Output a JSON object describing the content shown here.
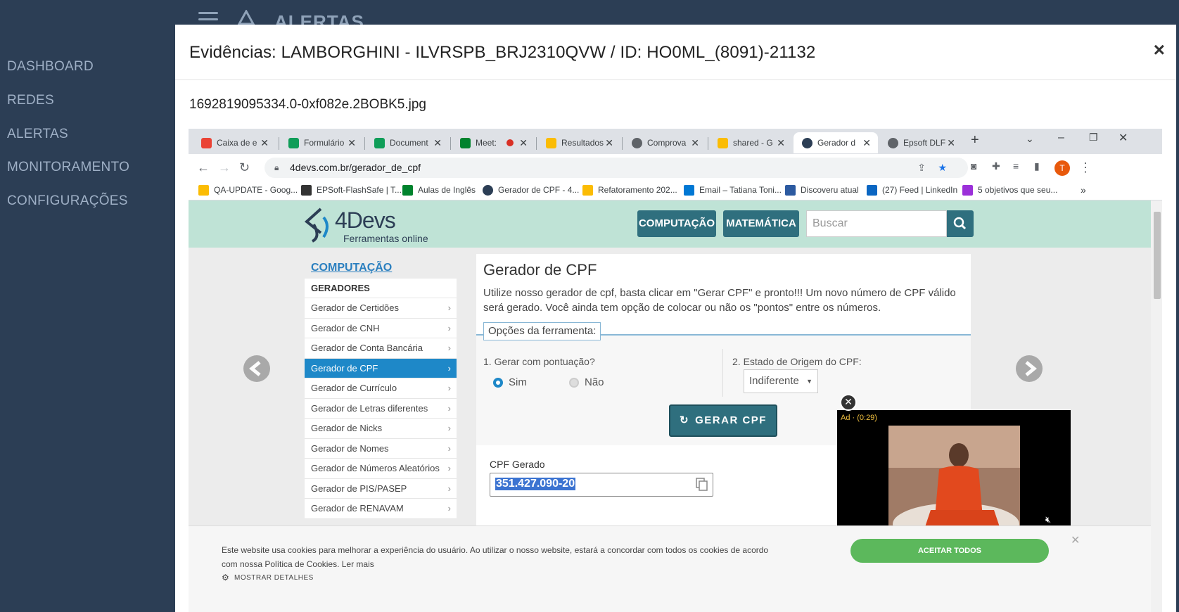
{
  "sidebar": {
    "items": [
      {
        "label": "DASHBOARD"
      },
      {
        "label": "REDES"
      },
      {
        "label": "ALERTAS"
      },
      {
        "label": "MONITORAMENTO"
      },
      {
        "label": "CONFIGURAÇÕES"
      }
    ]
  },
  "topbar": {
    "title": "ALERTAS"
  },
  "modal": {
    "title": "Evidências: LAMBORGHINI - ILVRSPB_BRJ2310QVW / ID: HO0ML_(8091)-21132",
    "close_label": "×",
    "filename": "1692819095334.0-0xf082e.2BOBK5.jpg"
  },
  "browser": {
    "tabs": [
      {
        "label": "Caixa de e",
        "icon": "gmail-icon",
        "color": "#ea4335"
      },
      {
        "label": "Formulário",
        "icon": "sheets-icon",
        "color": "#0f9d58"
      },
      {
        "label": "Document",
        "icon": "sheets-icon",
        "color": "#0f9d58"
      },
      {
        "label": "Meet:",
        "icon": "meet-icon",
        "color": "#00832d"
      },
      {
        "label": "Resultados",
        "icon": "drive-icon",
        "color": "#fbbc04"
      },
      {
        "label": "Comprova",
        "icon": "history-icon",
        "color": "#5f6368"
      },
      {
        "label": "shared - G",
        "icon": "drive-icon",
        "color": "#fbbc04"
      },
      {
        "label": "Gerador d",
        "icon": "4devs-icon",
        "color": "#2c3e55"
      },
      {
        "label": "Epsoft DLF",
        "icon": "globe-icon",
        "color": "#5f6368"
      }
    ],
    "url": "4devs.com.br/gerador_de_cpf",
    "bookmarks": [
      {
        "label": "QA-UPDATE - Goog...",
        "color": "#fbbc04"
      },
      {
        "label": "EPSoft-FlashSafe | T...",
        "color": "#333333"
      },
      {
        "label": "Aulas de Inglês",
        "color": "#00832d"
      },
      {
        "label": "Gerador de CPF - 4...",
        "color": "#2c3e55"
      },
      {
        "label": "Refatoramento 202...",
        "color": "#fbbc04"
      },
      {
        "label": "Email – Tatiana Toni...",
        "color": "#0078d4"
      },
      {
        "label": "Discoveru atual",
        "color": "#2c5aa0"
      },
      {
        "label": "(27) Feed | LinkedIn",
        "color": "#0a66c2"
      },
      {
        "label": "5 objetivos que seu...",
        "color": "#9b30d9"
      }
    ],
    "avatar_letter": "T"
  },
  "site": {
    "logo_main": "4Devs",
    "logo_sub": "Ferramentas online",
    "btn_computacao": "COMPUTAÇÃO",
    "btn_matematica": "MATEMÁTICA",
    "search_placeholder": "Buscar",
    "category_title": "COMPUTAÇÃO",
    "menu_head": "GERADORES",
    "menu_items": [
      "Gerador de Certidões",
      "Gerador de CNH",
      "Gerador de Conta Bancária",
      "Gerador de CPF",
      "Gerador de Currículo",
      "Gerador de Letras diferentes",
      "Gerador de Nicks",
      "Gerador de Nomes",
      "Gerador de Números Aleatórios",
      "Gerador de PIS/PASEP",
      "Gerador de RENAVAM"
    ],
    "content_title": "Gerador de CPF",
    "content_desc": "Utilize nosso gerador de cpf, basta clicar em \"Gerar CPF\" e pronto!!! Um novo número de CPF válido será gerado. Você ainda tem opção de colocar ou não os \"pontos\" entre os números.",
    "legend": "Opções da ferramenta:",
    "q1": "1. Gerar com pontuação?",
    "q2": "2. Estado de Origem do CPF:",
    "opt_sim": "Sim",
    "opt_nao": "Não",
    "estado_selected": "Indiferente",
    "gen_button": "GERAR CPF",
    "cpf_label": "CPF Gerado",
    "cpf_value": "351.427.090-20",
    "ad_label": "Ad · (0:29)",
    "cookie_text": "Este website usa cookies para melhorar a experiência do usuário. Ao utilizar o nosso website, estará a concordar com todos os cookies de acordo com nossa Política de Cookies. Ler mais",
    "cookie_details": "MOSTRAR DETALHES",
    "cookie_accept": "ACEITAR TODOS"
  }
}
